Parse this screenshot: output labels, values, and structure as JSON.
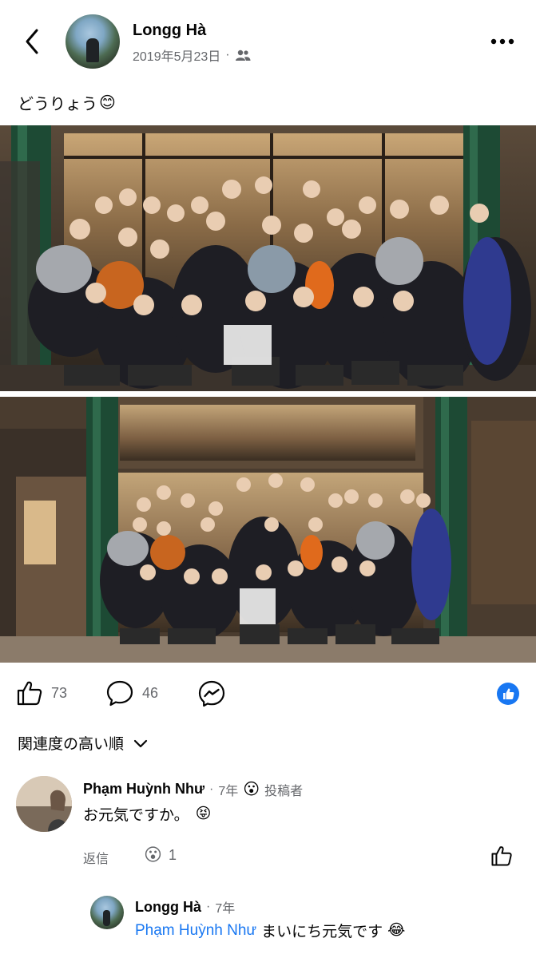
{
  "post": {
    "author": "Longg Hà",
    "date": "2019年5月23日",
    "meta_separator": "·",
    "text": "どうりょう",
    "text_emoji": "😊",
    "privacy_icon": "friends-icon"
  },
  "photos": [
    {
      "name": "group-photo-1"
    },
    {
      "name": "group-photo-2"
    }
  ],
  "reactions": {
    "likes": "73",
    "comments": "46",
    "like_badge_icon": "like-badge-icon"
  },
  "sort": {
    "label": "関連度の高い順"
  },
  "comments": [
    {
      "author": "Phạm Huỳnh Như",
      "time": "7年",
      "badge_emoji": "😮",
      "badge": "投稿者",
      "text": "お元気ですか。",
      "text_emoji": "😝",
      "reply_label": "返信",
      "reaction_emoji": "😮",
      "reaction_count": "1"
    }
  ],
  "replies": [
    {
      "author": "Longg Hà",
      "time": "7年",
      "mention": "Phạm Huỳnh Như",
      "text": "まいにち元気です",
      "text_emoji": "😂"
    }
  ],
  "colors": {
    "accent": "#1877f2",
    "muted": "#65676b",
    "text": "#050505"
  }
}
